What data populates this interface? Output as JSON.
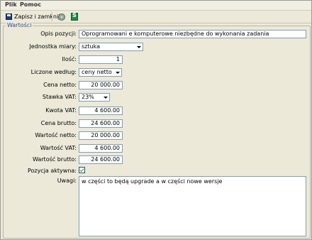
{
  "menu": {
    "file": "Plik",
    "help": "Pomoc"
  },
  "toolbar": {
    "save_close": "Zapisz i zamknij"
  },
  "group": {
    "title": "Wartości"
  },
  "form": {
    "description_label": "Opis pozycji:",
    "description_value": "Oprogramowani e komputerowe niezbędne do wykonania zadania",
    "unit_label": "Jednostka miary:",
    "unit_value": "sztuka",
    "qty_label": "Ilość:",
    "qty_value": "1",
    "calc_label": "Liczone według:",
    "calc_value": "ceny netto",
    "net_price_label": "Cena netto:",
    "net_price_value": "20 000.00",
    "vat_rate_label": "Stawka VAT:",
    "vat_rate_value": "23%",
    "vat_amount_label": "Kwota VAT:",
    "vat_amount_value": "4 600.00",
    "gross_price_label": "Cena brutto:",
    "gross_price_value": "24 600.00",
    "net_value_label": "Wartość netto:",
    "net_value_value": "20 000.00",
    "vat_value_label": "Wartość VAT:",
    "vat_value_value": "4 600.00",
    "gross_value_label": "Wartość brutto:",
    "gross_value_value": "24 600.00",
    "active_label": "Pozycja aktywna:",
    "active_checked": true,
    "notes_label": "Uwagi:",
    "notes_value": "w części to będą upgrade a w części nowe wersje"
  }
}
